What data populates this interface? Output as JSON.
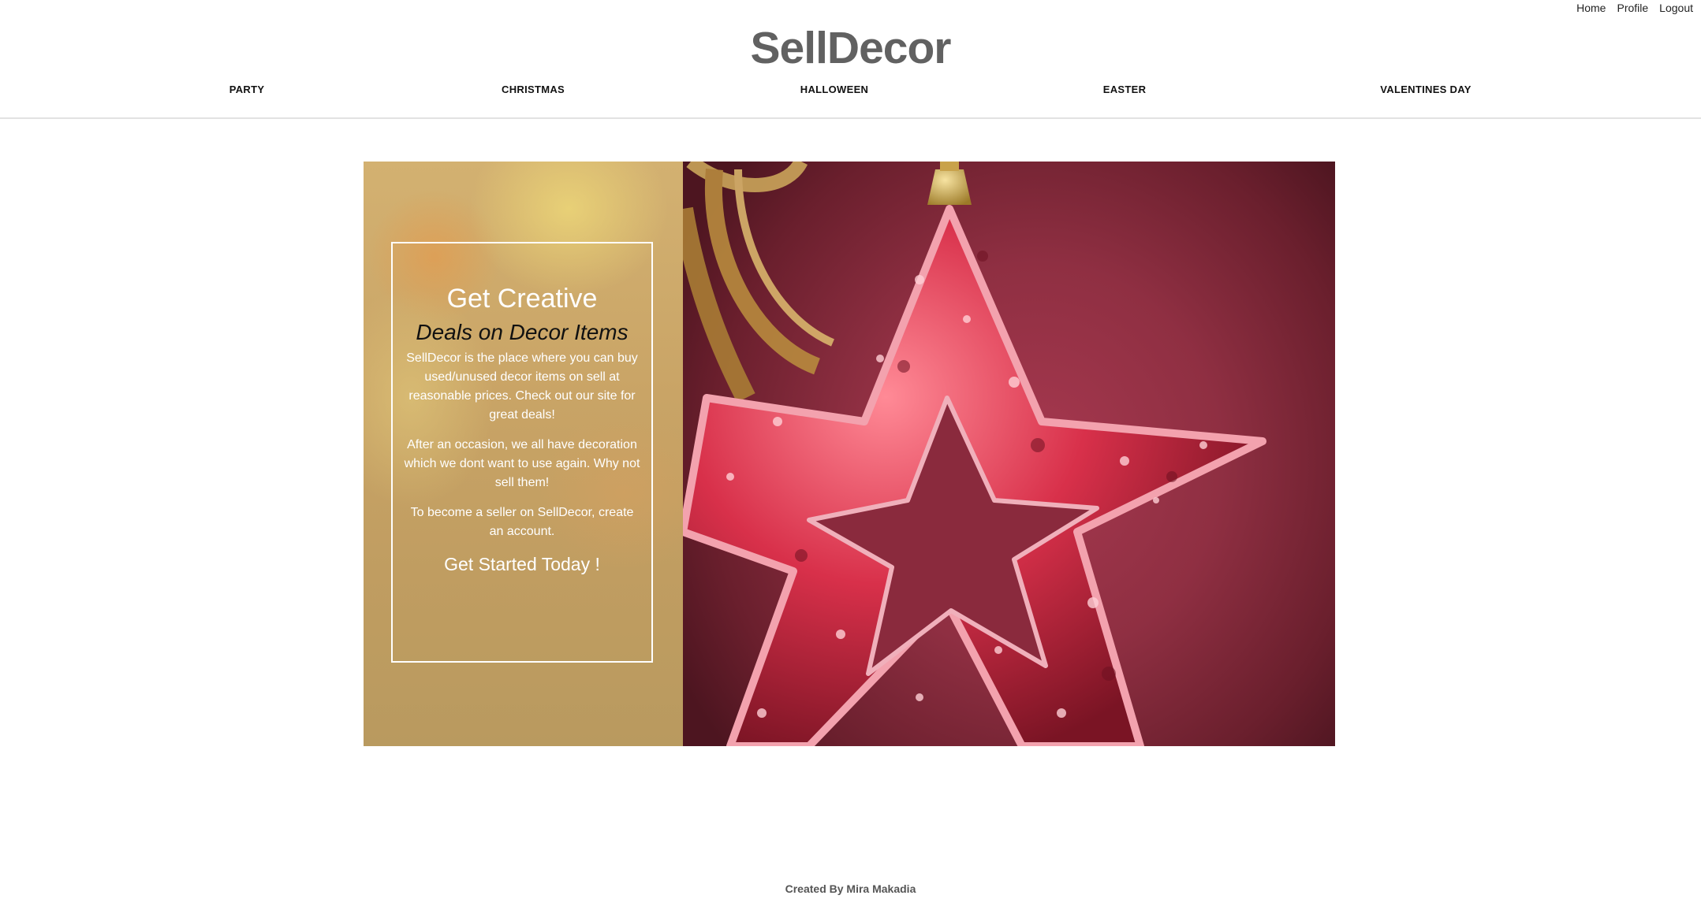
{
  "topnav": {
    "home": "Home",
    "profile": "Profile",
    "logout": "Logout"
  },
  "brand": {
    "title": "SellDecor"
  },
  "categories": [
    "PARTY",
    "CHRISTMAS",
    "HALLOWEEN",
    "EASTER",
    "VALENTINES DAY"
  ],
  "hero": {
    "heading": "Get Creative",
    "subheading": "Deals on Decor Items",
    "paragraphs": [
      "SellDecor is the place where you can buy used/unused decor items on sell at reasonable prices. Check out our site for great deals!",
      "After an occasion, we all have decoration which we dont want to use again. Why not sell them!",
      "To become a seller on SellDecor, create an account."
    ],
    "cta": "Get Started Today !"
  },
  "footer": {
    "credit": "Created By Mira Makadia"
  },
  "colors": {
    "brand_text": "#616161",
    "panel_tan": "#c9a466",
    "photo_red": "#8f2f42",
    "star_red": "#d8304a"
  }
}
